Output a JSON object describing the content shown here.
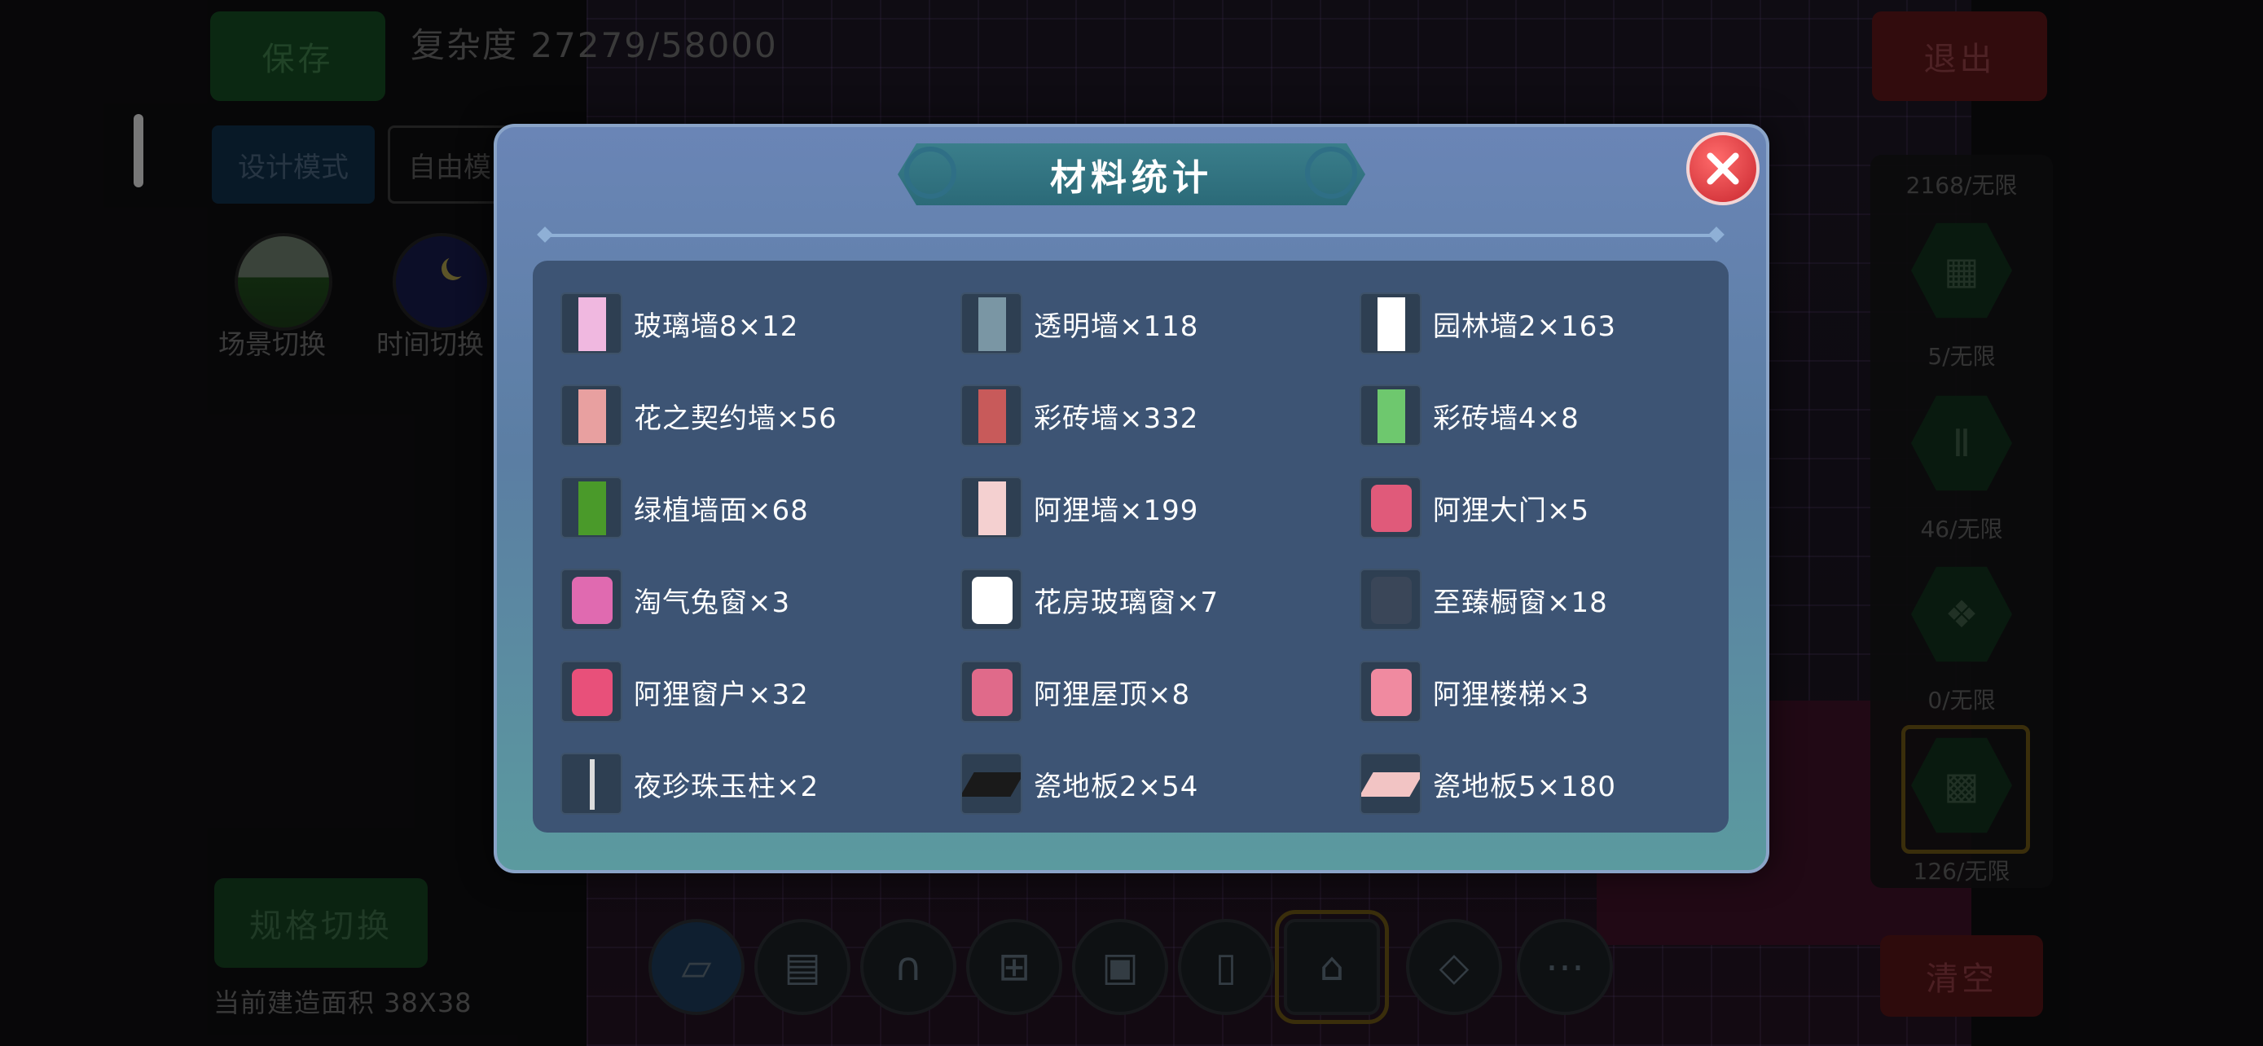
{
  "hud": {
    "save_label": "保存",
    "complexity_text": "复杂度 27279/58000",
    "exit_label": "退出",
    "mode_design_label": "设计模式",
    "mode_free_label": "自由模",
    "scene_switch_label": "场景切换",
    "time_switch_label": "时间切换",
    "spec_switch_label": "规格切换",
    "build_area_text": "当前建造面积 38X38",
    "clear_label": "清空"
  },
  "side_counts": [
    "2168/无限",
    "5/无限",
    "46/无限",
    "0/无限",
    "126/无限"
  ],
  "modal": {
    "title": "材料统计",
    "items": [
      {
        "label": "玻璃墙8×12",
        "icon": "glass-wall-icon",
        "color": "#f0b8e0"
      },
      {
        "label": "透明墙×118",
        "icon": "transparent-wall-icon",
        "color": "#7a96a4"
      },
      {
        "label": "园林墙2×163",
        "icon": "garden-wall-icon",
        "color": "#ffffff"
      },
      {
        "label": "花之契约墙×56",
        "icon": "flower-wall-icon",
        "color": "#e8a0a0"
      },
      {
        "label": "彩砖墙×332",
        "icon": "red-brick-wall-icon",
        "color": "#c85a5a"
      },
      {
        "label": "彩砖墙4×8",
        "icon": "green-brick-wall-icon",
        "color": "#6ec86e"
      },
      {
        "label": "绿植墙面×68",
        "icon": "plant-wall-icon",
        "color": "#4a9a2a"
      },
      {
        "label": "阿狸墙×199",
        "icon": "ali-wall-icon",
        "color": "#f4d0d0"
      },
      {
        "label": "阿狸大门×5",
        "icon": "ali-door-icon",
        "color": "#e05a7a"
      },
      {
        "label": "淘气兔窗×3",
        "icon": "bunny-window-icon",
        "color": "#e06ab0"
      },
      {
        "label": "花房玻璃窗×7",
        "icon": "greenhouse-window-icon",
        "color": "#ffffff"
      },
      {
        "label": "至臻橱窗×18",
        "icon": "showcase-window-icon",
        "color": "#3a4658"
      },
      {
        "label": "阿狸窗户×32",
        "icon": "ali-window-icon",
        "color": "#e8507a"
      },
      {
        "label": "阿狸屋顶×8",
        "icon": "ali-roof-icon",
        "color": "#e06a8a"
      },
      {
        "label": "阿狸楼梯×3",
        "icon": "ali-stairs-icon",
        "color": "#f08aa0"
      },
      {
        "label": "夜珍珠玉柱×2",
        "icon": "pearl-pillar-icon",
        "color": "#dcdcdc"
      },
      {
        "label": "瓷地板2×54",
        "icon": "dark-tile-floor-icon",
        "color": "#1a1a1a"
      },
      {
        "label": "瓷地板5×180",
        "icon": "pink-tile-floor-icon",
        "color": "#f2c4c4"
      }
    ]
  }
}
